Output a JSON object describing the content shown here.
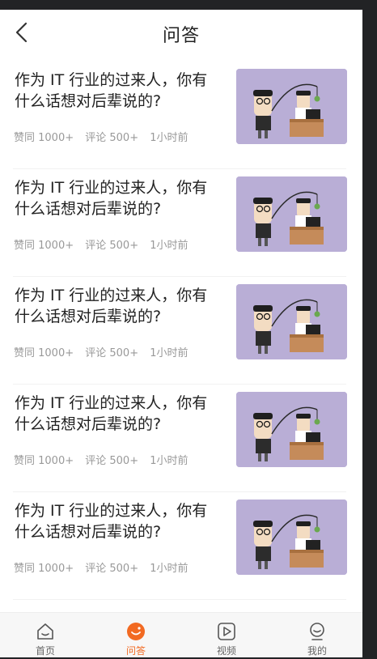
{
  "header": {
    "title": "问答"
  },
  "feed": {
    "items": [
      {
        "title": "作为 IT 行业的过来人，你有什么话想对后辈说的?",
        "likes": "赞同 1000+",
        "comments": "评论 500+",
        "time": "1小时前"
      },
      {
        "title": "作为 IT 行业的过来人，你有什么话想对后辈说的?",
        "likes": "赞同 1000+",
        "comments": "评论 500+",
        "time": "1小时前"
      },
      {
        "title": "作为 IT 行业的过来人，你有什么话想对后辈说的?",
        "likes": "赞同 1000+",
        "comments": "评论 500+",
        "time": "1小时前"
      },
      {
        "title": "作为 IT 行业的过来人，你有什么话想对后辈说的?",
        "likes": "赞同 1000+",
        "comments": "评论 500+",
        "time": "1小时前"
      },
      {
        "title": "作为 IT 行业的过来人，你有什么话想对后辈说的?",
        "likes": "赞同 1000+",
        "comments": "评论 500+",
        "time": "1小时前"
      }
    ]
  },
  "tabbar": {
    "tabs": [
      {
        "label": "首页",
        "icon": "home-icon"
      },
      {
        "label": "问答",
        "icon": "qa-icon",
        "active": true
      },
      {
        "label": "视频",
        "icon": "video-icon"
      },
      {
        "label": "我的",
        "icon": "profile-icon"
      }
    ]
  },
  "colors": {
    "accent": "#f26a22",
    "thumb_bg": "#b9aed6"
  }
}
